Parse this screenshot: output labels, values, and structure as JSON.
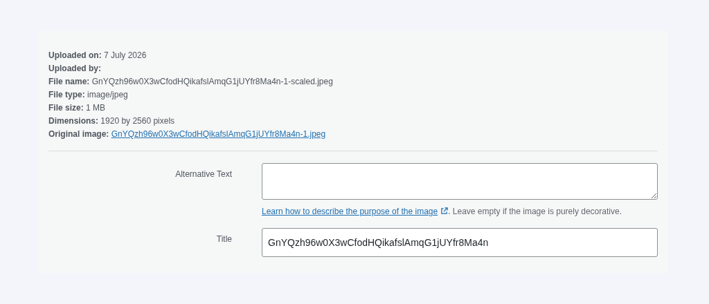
{
  "details": [
    {
      "label": "Uploaded on:",
      "value": "7 July 2026"
    },
    {
      "label": "Uploaded by:"
    },
    {
      "label": "File name:",
      "value": "GnYQzh96w0X3wCfodHQikafslAmqG1jUYfr8Ma4n-1-scaled.jpeg"
    },
    {
      "label": "File type:",
      "value": "image/jpeg"
    },
    {
      "label": "File size:",
      "value": "1 MB"
    },
    {
      "label": "Dimensions:",
      "value": "1920 by 2560 pixels"
    },
    {
      "label": "Original image:",
      "link": "GnYQzh96w0X3wCfodHQikafslAmqG1jUYfr8Ma4n-1.jpeg"
    }
  ],
  "fields": [
    {
      "kind": "textarea",
      "label": "Alternative Text",
      "help_link": "Learn how to describe the purpose of the image",
      "help_text": ". Leave empty if the image is purely decorative."
    },
    {
      "kind": "input",
      "label": "Title",
      "value": "GnYQzh96w0X3wCfodHQikafslAmqG1jUYfr8Ma4n"
    }
  ]
}
